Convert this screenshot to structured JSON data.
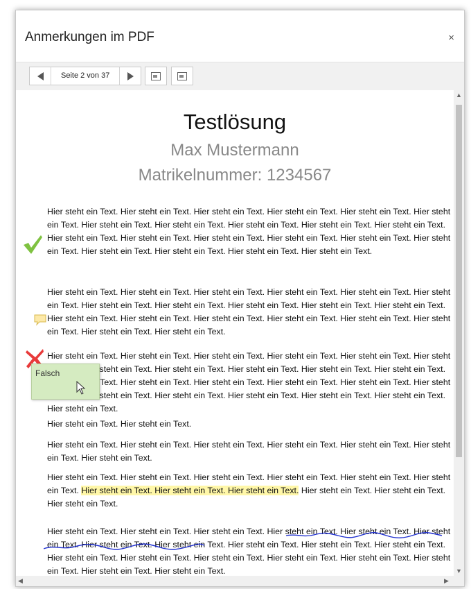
{
  "dialog": {
    "title": "Anmerkungen im PDF",
    "close_label": "×"
  },
  "toolbar": {
    "page_indicator": "Seite 2 von 37"
  },
  "document": {
    "title": "Testlösung",
    "name": "Max Mustermann",
    "matrikel": "Matrikelnummer: 1234567",
    "paragraphs": [
      "Hier steht ein Text. Hier steht ein Text. Hier steht ein Text. Hier steht ein Text. Hier steht ein Text. Hier steht ein Text. Hier steht ein Text. Hier steht ein Text. Hier steht ein Text. Hier steht ein Text. Hier steht ein Text. Hier steht ein Text. Hier steht ein Text. Hier steht ein Text. Hier steht ein Text. Hier steht ein Text. Hier steht ein Text. Hier steht ein Text. Hier steht ein Text. Hier steht ein Text. Hier steht ein Text.",
      "Hier steht ein Text. Hier steht ein Text. Hier steht ein Text. Hier steht ein Text. Hier steht ein Text. Hier steht ein Text. Hier steht ein Text. Hier steht ein Text. Hier steht ein Text. Hier steht ein Text. Hier steht ein Text. Hier steht ein Text. Hier steht ein Text. Hier steht ein Text. Hier steht ein Text. Hier steht ein Text. Hier steht ein Text. Hier steht ein Text. Hier steht ein Text.",
      "Hier steht ein Text. Hier steht ein Text. Hier steht ein Text. Hier steht ein Text. Hier steht ein Text. Hier steht ein Text. Hier steht ein Text. Hier steht ein Text. Hier steht ein Text. Hier steht ein Text. Hier steht ein Text. Hier steht ein Text. Hier steht ein Text. Hier steht ein Text. Hier steht ein Text. Hier steht ein Text. Hier steht ein Text. Hier steht ein Text. Hier steht ein Text. Hier steht ein Text. Hier steht ein Text. Hier steht ein Text. Hier steht ein Text.",
      "Hier steht ein Text. Hier steht ein Text.",
      "Hier steht ein Text. Hier steht ein Text. Hier steht ein Text. Hier steht ein Text. Hier steht ein Text. Hier steht ein Text. Hier steht ein Text.",
      "Hier steht ein Text. Hier steht ein Text. Hier steht ein Text. Hier steht ein Text. Hier steht ein Text. Hier steht ein Text. Hier steht ein Text. Hier steht ein Text. Hier steht ein Text. Hier steht ein Text. Hier steht ein Text. Hier steht ein Text.",
      "Hier steht ein Text. Hier steht ein Text. Hier steht ein Text. Hier steht ein Text. Hier steht ein Text. Hier steht ein Text. Hier steht ein Text. Hier steht ein Text. Hier steht ein Text. Hier steht ein Text. Hier steht ein Text. Hier steht ein Text. Hier steht ein Text. Hier steht ein Text. Hier steht ein Text. Hier steht ein Text. Hier steht ein Text. Hier steht ein Text. Hier steht ein Text."
    ],
    "para6_before": "Hier steht ein Text. Hier steht ein Text. Hier steht ein Text. Hier steht ein Text. Hier steht ein Text. Hier steht ein Text. ",
    "para6_highlight": "Hier steht ein Text. Hier steht ein Text. Hier steht ein Text.",
    "para6_after": " Hier steht ein Text. Hier steht ein Text. Hier steht ein Text."
  },
  "annotations": {
    "popup_text": "Falsch",
    "check_color": "#7fc241",
    "cross_color": "#e83a3a",
    "note_color": "#fde9a8",
    "highlight_color": "#fff7a8",
    "underline_color": "#1f2fd0"
  }
}
